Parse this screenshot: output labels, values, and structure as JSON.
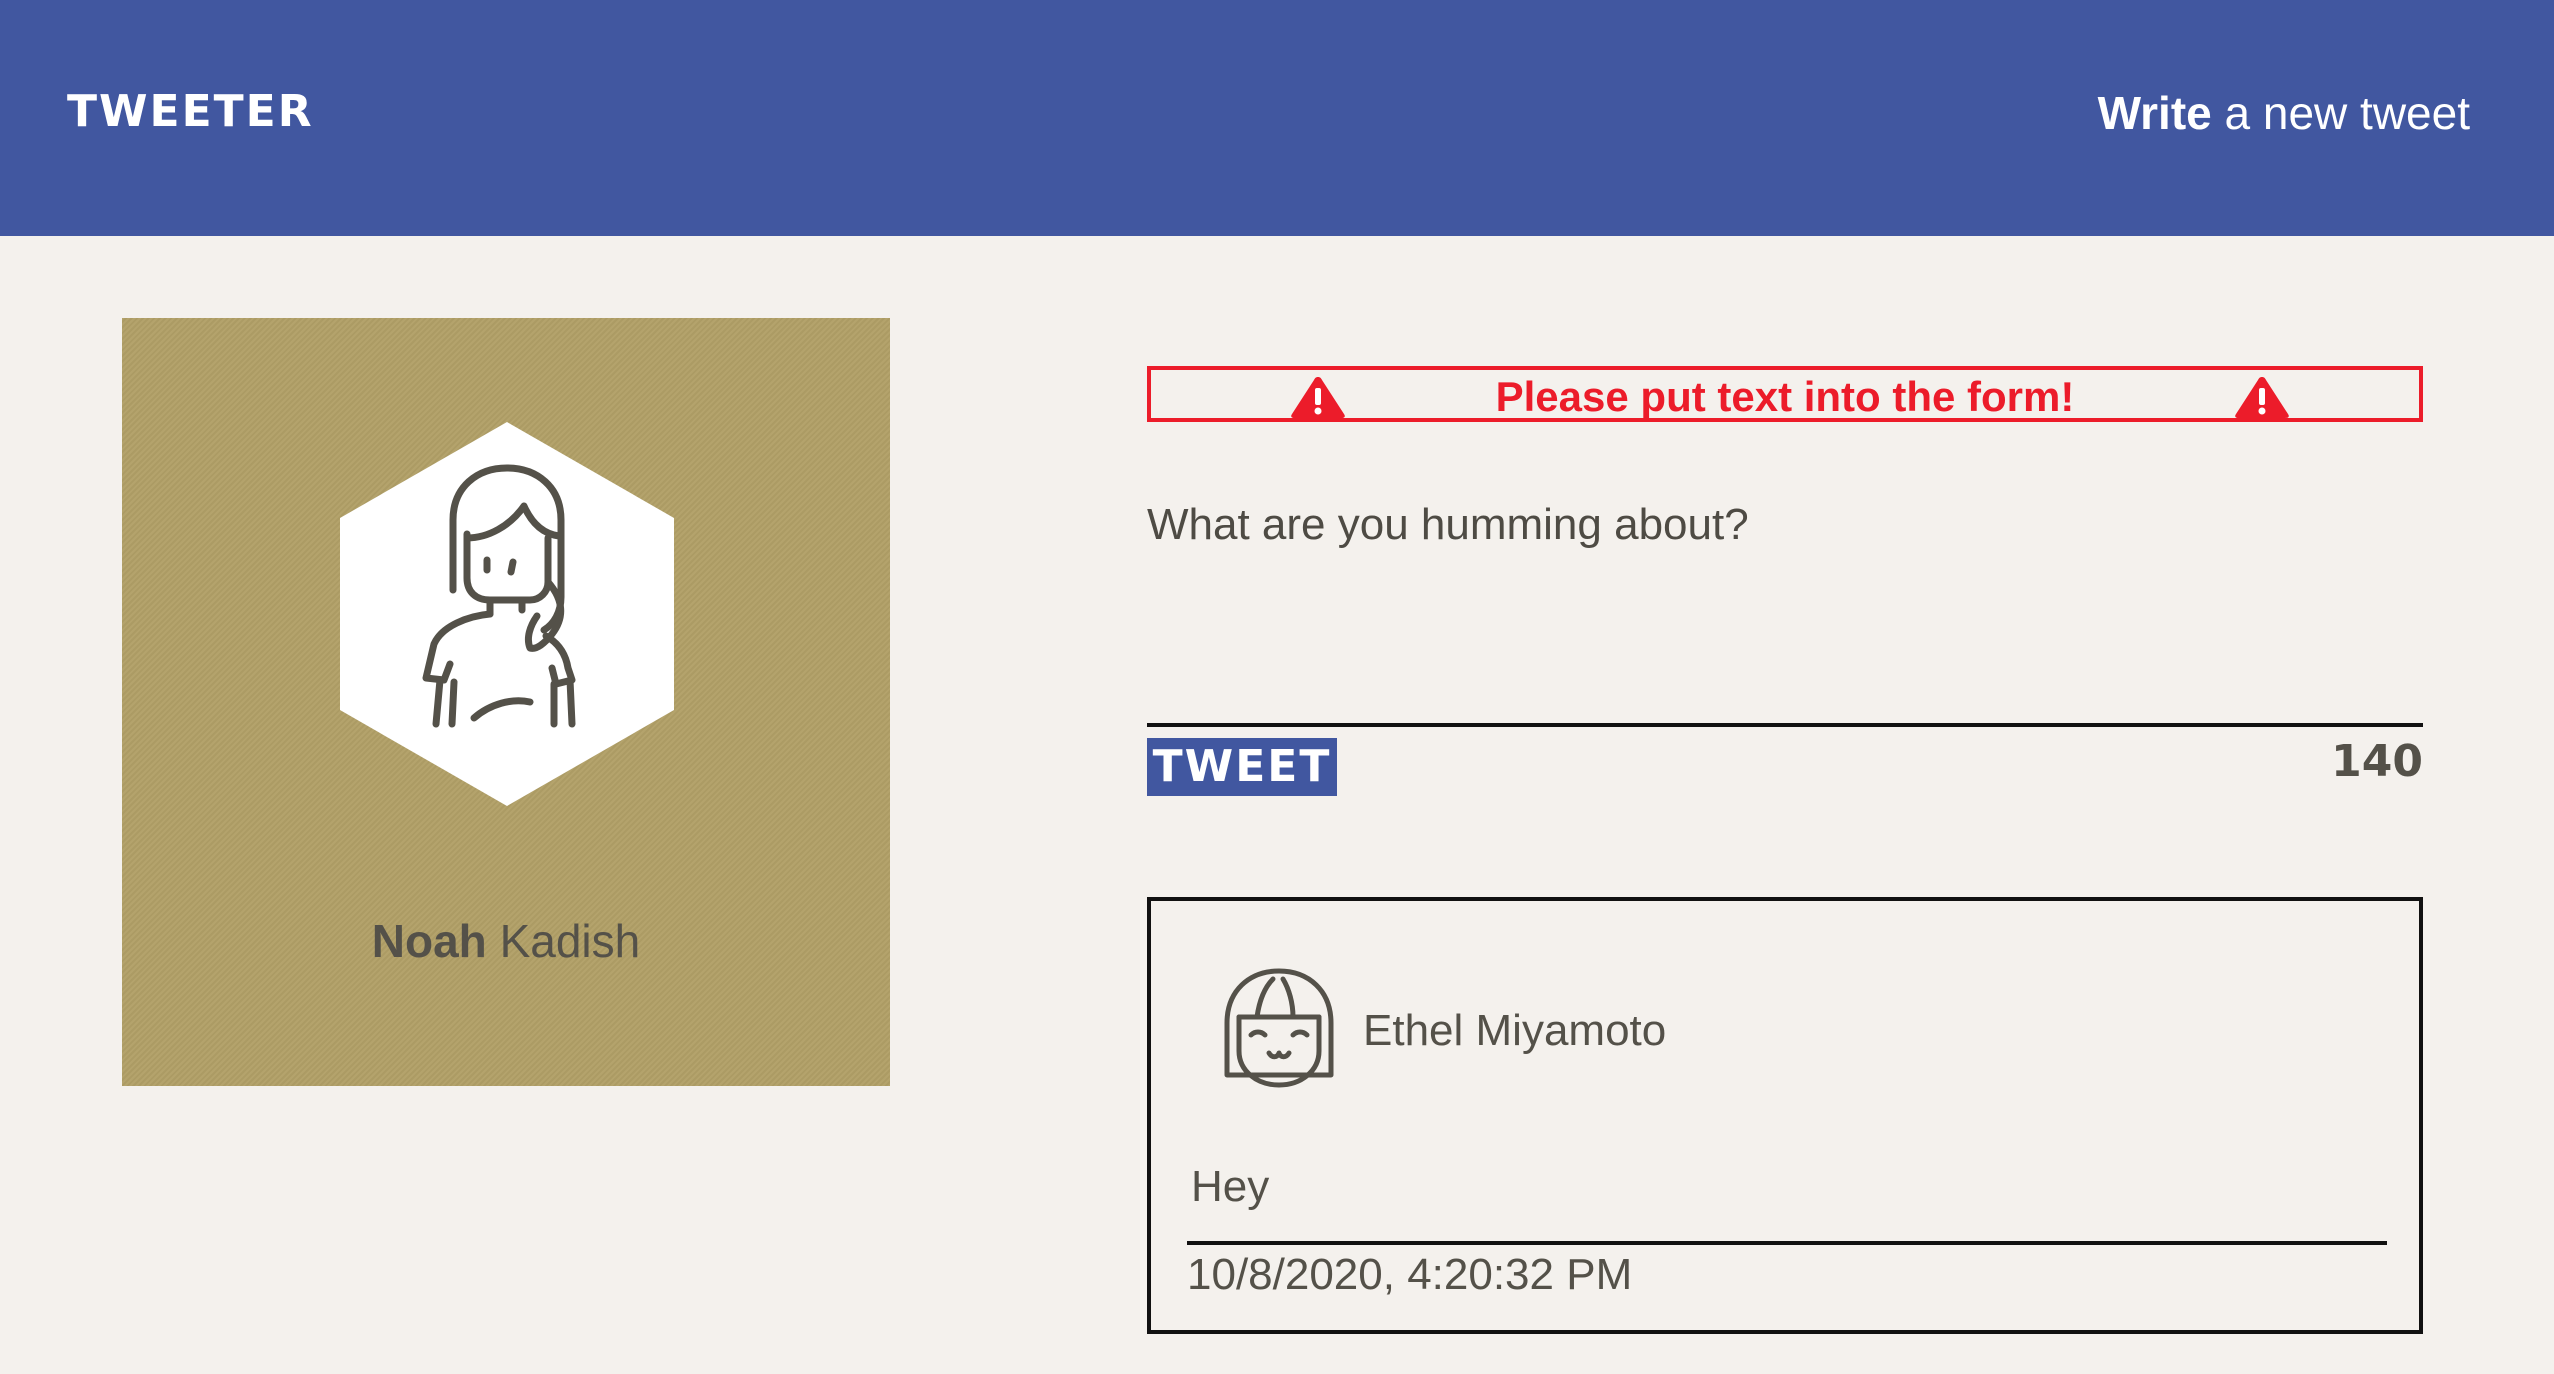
{
  "nav": {
    "brand": "TWEETER",
    "compose_bold": "Write",
    "compose_rest": " a new tweet",
    "background": "#4157a0"
  },
  "profile": {
    "first_name": "Noah",
    "last_name": "Kadish",
    "avatar_icon": "woman-avatar-icon",
    "card_color": "#b1a067"
  },
  "compose": {
    "error_message": "Please put text into the form!",
    "error_icon": "warning-triangle-icon",
    "error_color": "#ec1c2a",
    "placeholder": "What are you humming about?",
    "value": "",
    "submit_label": "TWEET",
    "char_counter": "140"
  },
  "tweets": [
    {
      "author": "Ethel Miyamoto",
      "avatar_icon": "girl-avatar-icon",
      "text": "Hey",
      "timestamp": "10/8/2020, 4:20:32 PM"
    }
  ]
}
